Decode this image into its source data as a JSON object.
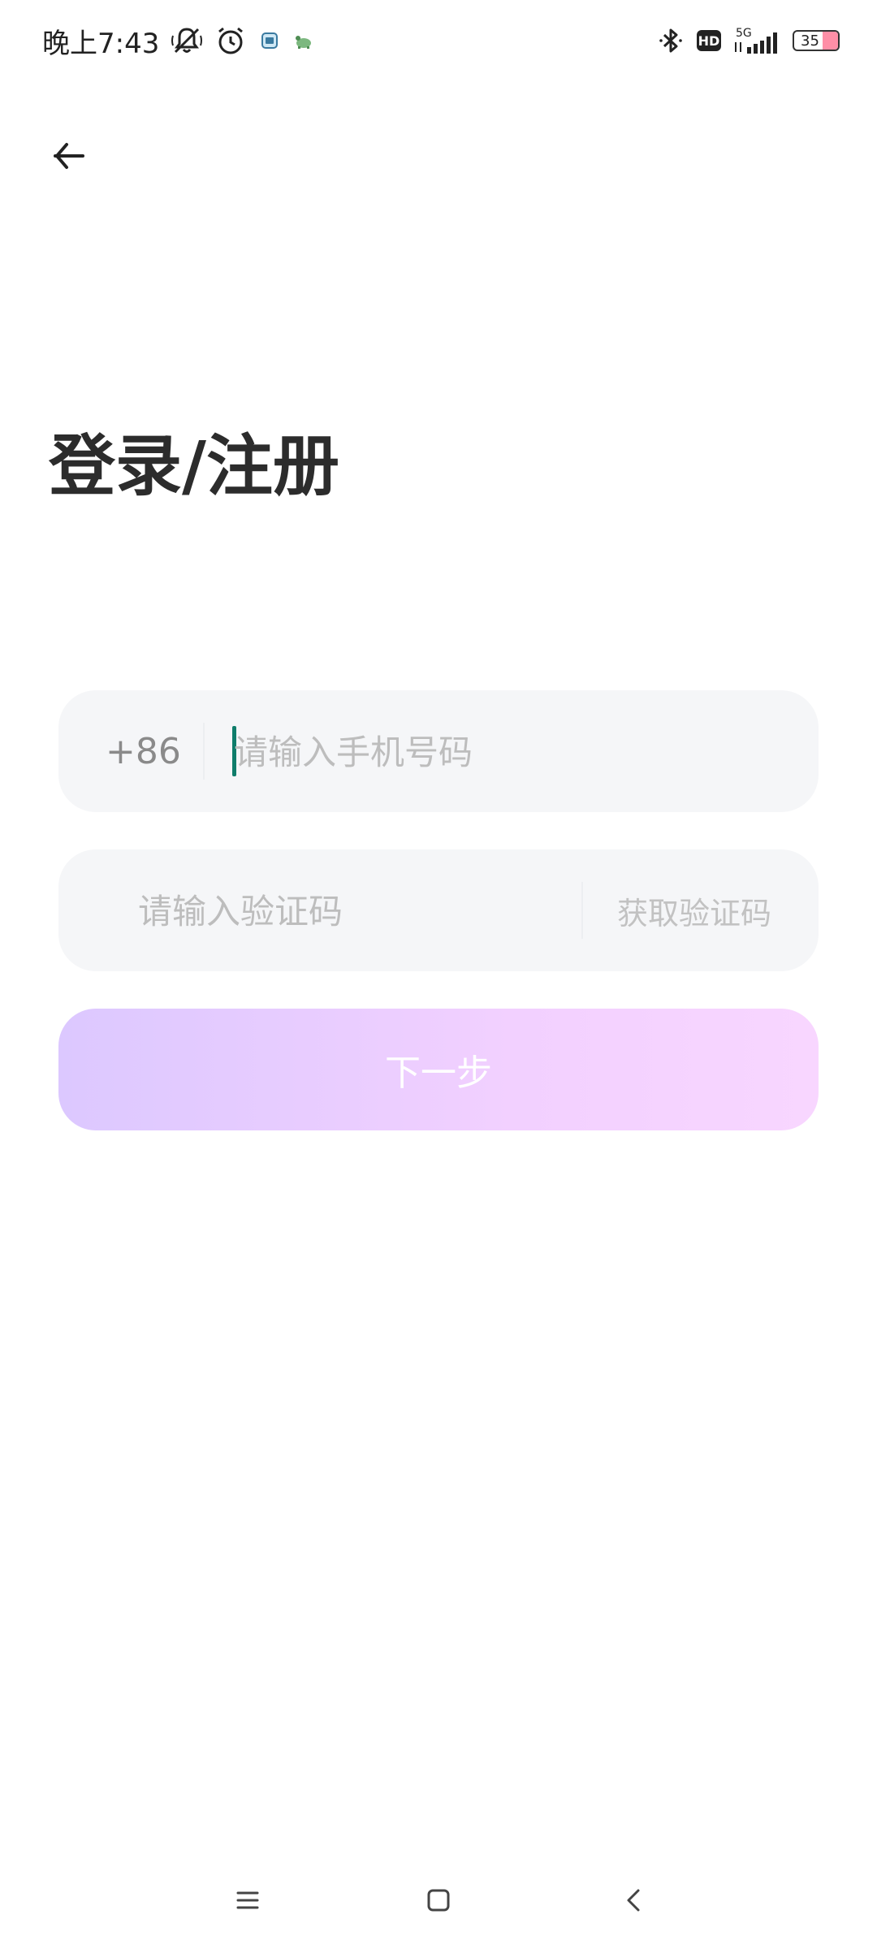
{
  "status_bar": {
    "time": "晚上7:43",
    "network": "5G",
    "hd": "HD",
    "battery": {
      "level": 35,
      "text": "35"
    },
    "icons": [
      "mute-bell-icon",
      "alarm-icon",
      "app-notification-icon",
      "turtle-icon",
      "bluetooth-icon",
      "hd-icon",
      "signal-icon",
      "battery-icon"
    ]
  },
  "header": {
    "back_icon": "arrow-left-icon"
  },
  "page": {
    "title": "登录/注册"
  },
  "phone": {
    "country_code": "+86",
    "placeholder": "请输入手机号码",
    "value": ""
  },
  "code": {
    "placeholder": "请输入验证码",
    "value": "",
    "get_code_label": "获取验证码"
  },
  "next_button": {
    "label": "下一步"
  },
  "nav_bar": {
    "icons": [
      "menu-icon",
      "home-icon",
      "back-icon"
    ]
  },
  "colors": {
    "caret": "#0f7d6b",
    "field_bg": "#f5f6f8",
    "button_gradient_start": "#dcc8ff",
    "button_gradient_end": "#f8d6ff",
    "battery_fill": "#ff8fa7"
  }
}
